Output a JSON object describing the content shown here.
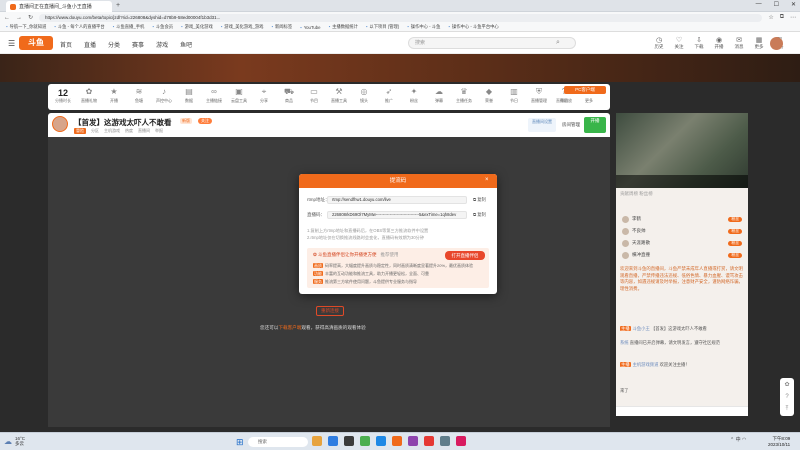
{
  "browser": {
    "tab_title": "直播间正在直播间_斗鱼小王直播",
    "url": "https://www.douyu.com/beta/topic/jzdl?rid=226808&dyshid=d78b9-58ed00004f1b3d31...",
    "bookmarks": [
      "导航一下_你就知道",
      "斗鱼 - 每个人的直播平台",
      "斗鱼直播_手机",
      "斗鱼会员",
      "游戏_美化游戏",
      "游戏_美化游戏_游戏",
      "新闻标签",
      "YouTube",
      "主播数据统计",
      "以下项目 (管理)",
      "操作中心 - 斗鱼",
      "操作中心 - 斗鱼平台中心"
    ]
  },
  "site": {
    "logo": "斗鱼",
    "nav": [
      "首页",
      "直播",
      "分类",
      "赛事",
      "游戏",
      "鱼吧"
    ],
    "search_placeholder": "搜索",
    "header_icons": [
      {
        "icon": "history-icon",
        "label": "历史"
      },
      {
        "icon": "follow-icon",
        "label": "关注"
      },
      {
        "icon": "download-icon",
        "label": "下载"
      },
      {
        "icon": "live-icon",
        "label": "开播"
      },
      {
        "icon": "message-icon",
        "label": "消息"
      },
      {
        "icon": "grid-icon",
        "label": "更多"
      },
      {
        "icon": "task-icon",
        "label": "任务"
      }
    ]
  },
  "toolbar": {
    "count": "12",
    "count_label": "分播时长",
    "items": [
      {
        "icon": "gift-icon",
        "label": "直播礼物"
      },
      {
        "icon": "star-icon",
        "label": "开播"
      },
      {
        "icon": "wave-icon",
        "label": "鱼塘"
      },
      {
        "icon": "mic-icon",
        "label": "声控中心"
      },
      {
        "icon": "chart-icon",
        "label": "数据"
      },
      {
        "icon": "link-icon",
        "label": "主播链接"
      },
      {
        "icon": "box-icon",
        "label": "云盘工具"
      },
      {
        "icon": "pin-icon",
        "label": "分享"
      },
      {
        "icon": "cart-icon",
        "label": "商品"
      },
      {
        "icon": "doc-icon",
        "label": "节目"
      },
      {
        "icon": "tool-icon",
        "label": "直播工具"
      },
      {
        "icon": "cam-icon",
        "label": "镜头"
      },
      {
        "icon": "rocket-icon",
        "label": "推广"
      },
      {
        "icon": "fan-icon",
        "label": "粉丝"
      },
      {
        "icon": "cloud-icon",
        "label": "弹幕"
      },
      {
        "icon": "trophy-icon",
        "label": "主播任务"
      },
      {
        "icon": "diamond-icon",
        "label": "荣誉"
      },
      {
        "icon": "calendar-icon",
        "label": "节日"
      },
      {
        "icon": "shield-icon",
        "label": "直播管理"
      },
      {
        "icon": "help-icon",
        "label": "帮助"
      },
      {
        "icon": "more-icon",
        "label": "更多"
      }
    ],
    "pc_button": "PC客户端",
    "side_text": "直播回放"
  },
  "stream": {
    "title": "【首发】这游戏太吓人不敢看",
    "badge1": "新版",
    "badge2": "关注",
    "meta": [
      "冒险",
      "分区",
      "主机游戏",
      "热度",
      "直播间",
      "举报"
    ],
    "btn1": "直播间设置",
    "btn2": "房间管理",
    "btn3": "开播"
  },
  "player": {
    "reconnect": "重新连接",
    "tip_prefix": "您还可以",
    "tip_link": "下载客户端",
    "tip_suffix": "观看，获得高清画质的观看体验"
  },
  "modal": {
    "title": "提流码",
    "rtmp_label": "rtmp地址：",
    "rtmp_value": "rtmp://sendfhw1.douyu.com/live",
    "key_label": "直播码：",
    "key_value": "226808rkD69Ol7MyMw-------------------------------5&exTime=1qh8dev",
    "copy": "复制",
    "note1": "1.复制上方rtmp地址和直播码后，在OBS等第三方推流软件中设置",
    "note2": "2.rtmp地址仅在切换推流线路时会变化，直播码有效期为30分钟",
    "promo_title": "斗鱼直播伴侣让你开播更方便",
    "promo_sub": "推荐使用",
    "promo_button": "打开直播伴侣",
    "promo_lines": [
      {
        "tag": "画质",
        "text": "码率提高，大幅度提升画质与稳定性，同时画质清晰度显著提升20%，最优画质体验"
      },
      {
        "tag": "功能",
        "text": "丰富的互动功能和推流工具，助力开播更轻松，全面、可靠"
      },
      {
        "tag": "服务",
        "text": "推流第三方软件使用问题，斗鱼提供专业服务与指导"
      }
    ]
  },
  "side": {
    "rank_header": "贡献周榜 粉丝榜",
    "ranks": [
      {
        "name": "李鹤",
        "badge": "粉丝"
      },
      {
        "name": "不良帅",
        "badge": "粉丝"
      },
      {
        "name": "天涯路散",
        "badge": "粉丝"
      },
      {
        "name": "横冲直撞",
        "badge": "粉丝"
      }
    ],
    "notice": "欢迎来到斗鱼的直播间，斗鱼严禁未成年人直播或打赏，请文明观看直播，严禁传播违法违规、低俗色情、暴力血腥、谩骂攻击等内容，如遇违规请及时举报，注意财产安全，谨防网络诈骗，理性消费。",
    "chat": [
      {
        "badge": "主播",
        "user": "斗鱼小王",
        "text": "【首发】这游戏太吓人不敢看"
      },
      {
        "badge": "",
        "user": "系统",
        "text": "直播间已开启弹幕，请文明发言，遵守社区规范"
      },
      {
        "badge": "主播",
        "user": "主机游戏频道",
        "text": "欢迎关注主播！"
      },
      {
        "badge": "",
        "user": "",
        "text": "来了"
      }
    ]
  },
  "taskbar": {
    "weather_temp": "16°C",
    "weather_desc": "多云",
    "search": "搜索",
    "time": "下午8:09",
    "date": "2023/10/11",
    "lang": "中"
  }
}
